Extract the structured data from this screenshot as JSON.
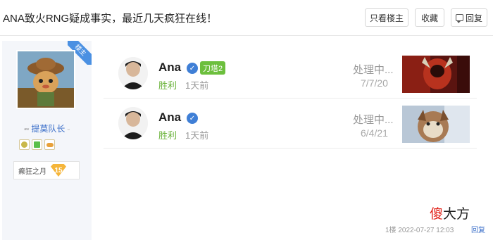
{
  "thread": {
    "title": "ANA致火RNG疑成事实，最近几天疯狂在线！"
  },
  "header_buttons": {
    "only_op": "只看楼主",
    "favorite": "收藏",
    "reply": "回复"
  },
  "author": {
    "op_tag": "楼主",
    "name": "提莫队长",
    "honor_label": "癫狂之月",
    "level": "15"
  },
  "matches": [
    {
      "player": "Ana",
      "tag": "刀塔2",
      "result": "胜利",
      "time_ago": "1天前",
      "status": "处理中...",
      "date": "7/7/20"
    },
    {
      "player": "Ana",
      "tag": "",
      "result": "胜利",
      "time_ago": "1天前",
      "status": "处理中...",
      "date": "6/4/21"
    }
  ],
  "post_footer": {
    "floor_time": "1楼  2022-07-27 12:03",
    "reply": "回复"
  },
  "watermark": {
    "first_char": "傻",
    "rest": "大方"
  },
  "colors": {
    "accent_blue": "#4a90e2",
    "win_green": "#6bb33b",
    "tag_green": "#6cbf3d",
    "watermark_red": "#e2241b"
  }
}
